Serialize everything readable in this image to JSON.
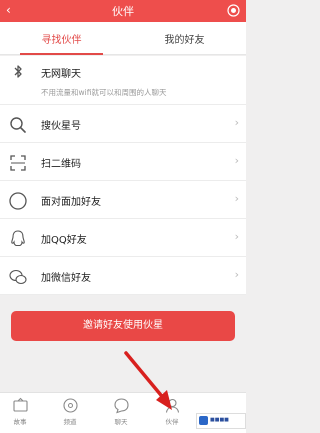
{
  "header": {
    "title": "伙伴",
    "back_icon": "back-arrow-icon",
    "action_icon": "red-circle-icon"
  },
  "tabs": [
    {
      "label": "寻找伙伴",
      "active": true
    },
    {
      "label": "我的好友",
      "active": false
    }
  ],
  "list": [
    {
      "label": "无网聊天",
      "desc": "不用流量和wifi就可以和周围的人聊天",
      "icon": "bluetooth-icon",
      "chevron": false
    },
    {
      "label": "搜伙星号",
      "icon": "search-icon",
      "chevron": true
    },
    {
      "label": "扫二维码",
      "icon": "scan-icon",
      "chevron": true
    },
    {
      "label": "面对面加好友",
      "icon": "face-to-face-icon",
      "chevron": true
    },
    {
      "label": "加QQ好友",
      "icon": "qq-icon",
      "chevron": true
    },
    {
      "label": "加微信好友",
      "icon": "wechat-icon",
      "chevron": true
    }
  ],
  "invite_button": "邀请好友使用伙星",
  "bottom_nav": [
    {
      "label": "故事",
      "icon": "story-icon"
    },
    {
      "label": "频道",
      "icon": "channel-icon"
    },
    {
      "label": "聊天",
      "icon": "chat-icon"
    },
    {
      "label": "伙伴",
      "icon": "partner-icon",
      "active": true
    }
  ],
  "colors": {
    "accent": "#ee4e4c",
    "background": "#f0efef"
  }
}
